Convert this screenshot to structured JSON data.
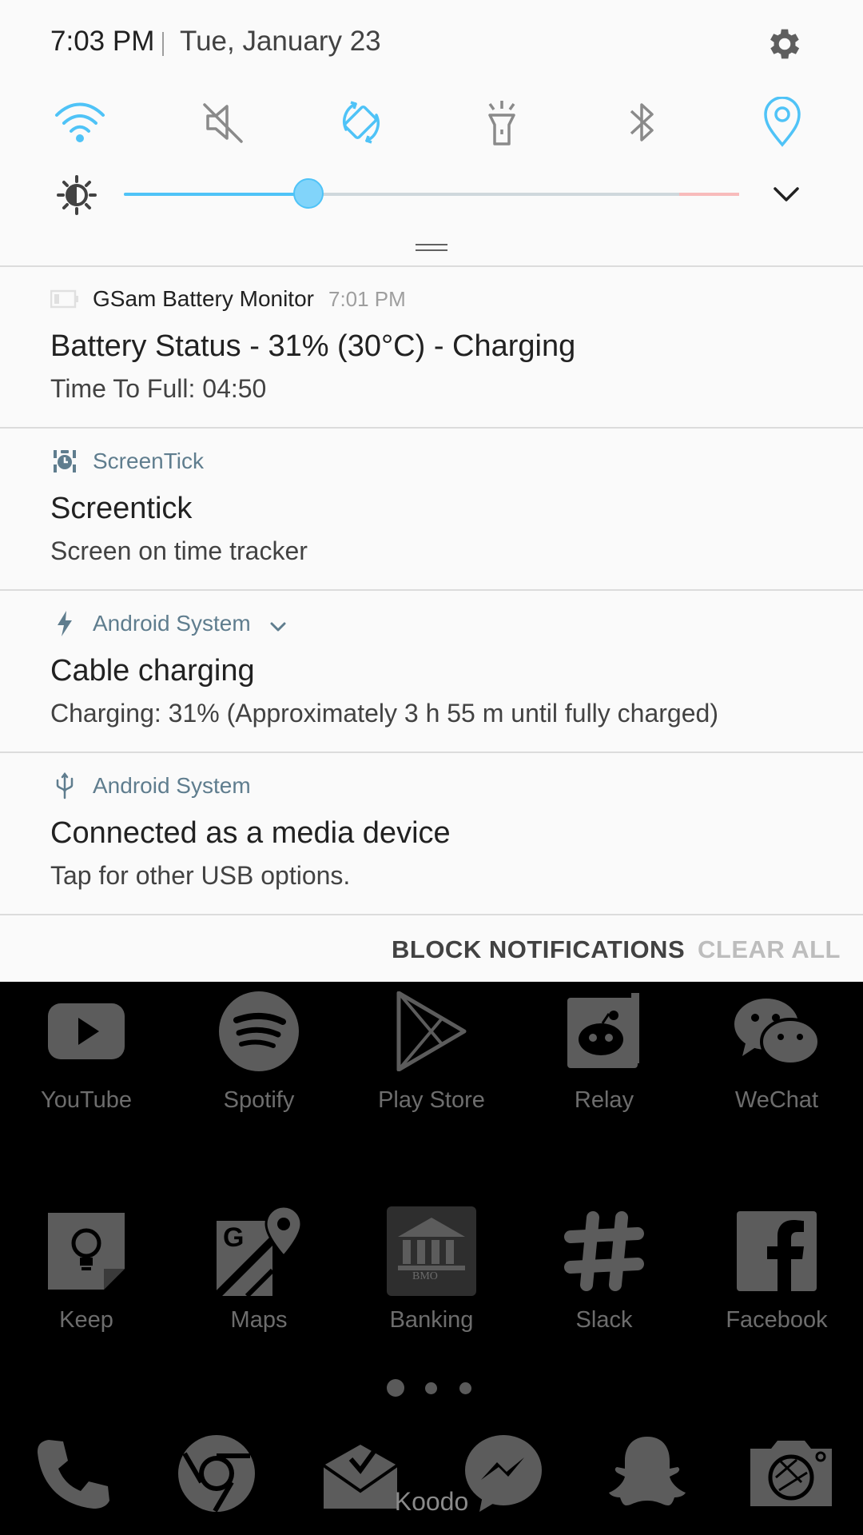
{
  "status": {
    "time": "7:03 PM",
    "date": "Tue, January 23"
  },
  "quick_settings": {
    "tiles": [
      {
        "icon": "wifi-icon",
        "active": true
      },
      {
        "icon": "sound-off-icon",
        "active": false
      },
      {
        "icon": "auto-rotate-icon",
        "active": true
      },
      {
        "icon": "flashlight-icon",
        "active": false
      },
      {
        "icon": "bluetooth-icon",
        "active": false
      },
      {
        "icon": "location-icon",
        "active": true
      }
    ],
    "brightness_level": 0.3
  },
  "notifications": [
    {
      "icon": "battery-monitor-icon",
      "app": "GSam Battery Monitor",
      "time": "7:01 PM",
      "title": "Battery Status - 31% (30°C) - Charging",
      "text": "Time To Full: 04:50"
    },
    {
      "icon": "screentick-icon",
      "app": "ScreenTick",
      "title": "Screentick",
      "text": "Screen on time tracker"
    },
    {
      "icon": "bolt-icon",
      "app": "Android System",
      "title": "Cable charging",
      "text": "Charging: 31% (Approximately 3 h 55 m until fully charged)"
    },
    {
      "icon": "usb-icon",
      "app": "Android System",
      "title": "Connected as a media device",
      "text": "Tap for other USB options."
    }
  ],
  "actions": {
    "block": "BLOCK NOTIFICATIONS",
    "clear": "CLEAR ALL"
  },
  "home": {
    "row1": [
      "YouTube",
      "Spotify",
      "Play Store",
      "Relay",
      "WeChat"
    ],
    "row2": [
      "Keep",
      "Maps",
      "Banking",
      "Slack",
      "Facebook"
    ],
    "dock": [
      "phone-icon",
      "chrome-icon",
      "email-icon",
      "messenger-icon",
      "snapchat-icon",
      "camera-icon"
    ],
    "carrier": "Koodo",
    "banking_badge": "BMO"
  },
  "colors": {
    "accent": "#4fc3f7",
    "app_label": "#5f7d8e"
  }
}
